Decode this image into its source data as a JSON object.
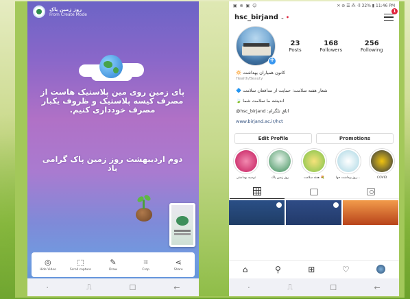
{
  "left_phone": {
    "story_user": "روز زمین پاک",
    "story_mode": "From Create Mode",
    "text_block_1": "پای زمین روی مین پلاستیک هاست از مصرف کیسه پلاستیک و ظروف یکبار مصرف خودداری کنیم.",
    "text_block_2": "دوم اردیبهشت روز زمین پاک گرامی باد",
    "toolbar": [
      {
        "icon": "hide-icon",
        "glyph": "◎",
        "label": "Hide Video"
      },
      {
        "icon": "scroll-capture-icon",
        "glyph": "⬚",
        "label": "Scroll capture"
      },
      {
        "icon": "draw-icon",
        "glyph": "✎",
        "label": "Draw"
      },
      {
        "icon": "crop-icon",
        "glyph": "⌗",
        "label": "Crop"
      },
      {
        "icon": "share-icon",
        "glyph": "⋖",
        "label": "Share"
      }
    ],
    "nav": {
      "menu": "⋅",
      "recents": "⎍",
      "home": "☐",
      "back": "←"
    }
  },
  "right_phone": {
    "status_left": "▣ ⊗ ▣ ☺",
    "status_right": "✕ ⊘ ☰ ⁂ ⋅ll 32% ▮ 11:46 PM",
    "username": "hsc_birjand",
    "chevron": "⌄",
    "dot": "•",
    "notif_count": "1",
    "stats": [
      {
        "value": "23",
        "label": "Posts"
      },
      {
        "value": "168",
        "label": "Followers"
      },
      {
        "value": "256",
        "label": "Following"
      }
    ],
    "bio": {
      "line1": "کانون همیاران بهداشت 🔆",
      "line1_sub": "Health/Beauty",
      "line2": "شعار هفته سلامت: حمایت از مدافعان سلامت 🔷",
      "line3": "اندیشه ما سلامت شما 🍃",
      "line4": "@hsc_birjand :اتاق تلگرام",
      "link": "www.birjand.ac.ir/hct"
    },
    "buttons": {
      "edit": "Edit Profile",
      "promotions": "Promotions"
    },
    "highlights": [
      {
        "label": "توصیه بهداشتی",
        "color": "#e2457a"
      },
      {
        "label": "روز زمین پاک",
        "color": "#3d8f5a"
      },
      {
        "label": "هفته سلامت 💐",
        "color": "#7cc24b"
      },
      {
        "label": "روز بهداشت جها...",
        "color": "#cfe6ee"
      },
      {
        "label": "COVID",
        "color": "#2b3447"
      }
    ],
    "posts": [
      {
        "color": "#1f3d66"
      },
      {
        "color": "#223a6a"
      },
      {
        "color": "#e06d2b"
      }
    ],
    "bottom_nav": {
      "home": "⌂",
      "search": "⚲",
      "add": "⊞",
      "heart": "♡"
    }
  }
}
